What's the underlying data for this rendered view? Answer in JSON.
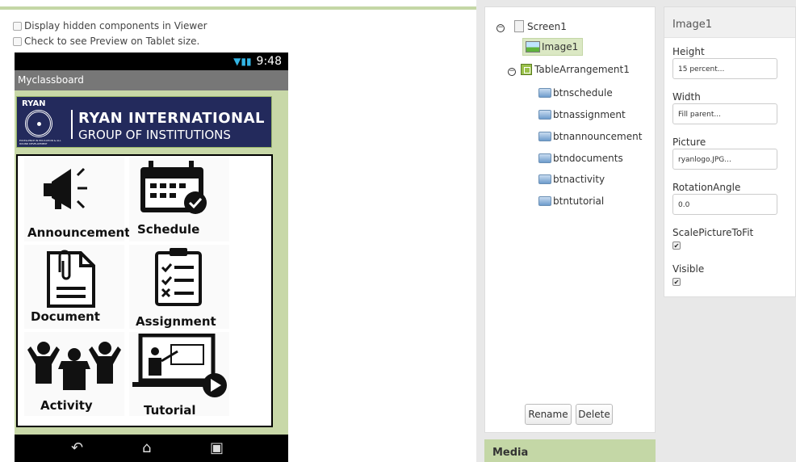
{
  "viewer": {
    "checkbox_hidden": "Display hidden components in Viewer",
    "checkbox_tablet": "Check to see Preview on Tablet size.",
    "status_time": "9:48",
    "app_title": "Myclassboard",
    "logo": {
      "brand": "RYAN",
      "line1": "RYAN INTERNATIONAL",
      "line2": "GROUP OF INSTITUTIONS",
      "tagline": "EXCELLENCE IN EDUCATION & ALL ROUND DEVELOPMENT"
    },
    "buttons": [
      "Announcement",
      "Schedule",
      "Document",
      "Assignment",
      "Activity",
      "Tutorial"
    ]
  },
  "components": {
    "screen": "Screen1",
    "image": "Image1",
    "table": "TableArrangement1",
    "children": [
      "btnschedule",
      "btnassignment",
      "btnannouncement",
      "btndocuments",
      "btnactivity",
      "btntutorial"
    ],
    "rename": "Rename",
    "delete": "Delete",
    "media": "Media"
  },
  "properties": {
    "title": "Image1",
    "height_label": "Height",
    "height_value": "15 percent...",
    "width_label": "Width",
    "width_value": "Fill parent...",
    "picture_label": "Picture",
    "picture_value": "ryanlogo.JPG...",
    "rotation_label": "RotationAngle",
    "rotation_value": "0.0",
    "scale_label": "ScalePictureToFit",
    "scale_checked": true,
    "visible_label": "Visible",
    "visible_checked": true
  },
  "colors": {
    "accent": "#c4d7a6",
    "selected": "#dbe8c4",
    "logo_bg": "#232a5c"
  }
}
